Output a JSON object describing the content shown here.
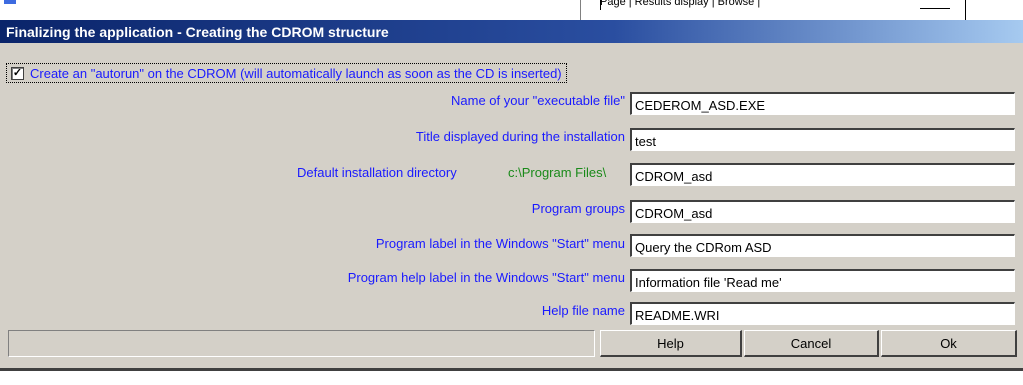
{
  "background_window": {
    "tabs_text": "Page | Results display | Browse |"
  },
  "dialog": {
    "title": "Finalizing the application - Creating the CDROM structure",
    "autorun": {
      "checked": true,
      "check_mark": "☑",
      "label": "Create an \"autorun\" on the CDROM (will automatically launch as soon as the CD is inserted)"
    },
    "fields": {
      "executable": {
        "label": "Name of your \"executable file\"",
        "value": "CEDEROM_ASD.EXE"
      },
      "install_title": {
        "label": "Title displayed during the installation",
        "value": "test"
      },
      "install_dir": {
        "label": "Default installation directory",
        "prefix": "c:\\Program Files\\",
        "value": "CDROM_asd"
      },
      "program_groups": {
        "label": "Program groups",
        "value": "CDROM_asd"
      },
      "program_label": {
        "label": "Program label in the Windows \"Start\" menu",
        "value": "Query the CDRom ASD"
      },
      "help_label": {
        "label": "Program help label in the Windows \"Start\" menu",
        "value": "Information file 'Read me'"
      },
      "help_file": {
        "label": "Help file name",
        "value": "README.WRI"
      }
    },
    "status_text": "",
    "buttons": {
      "help": "Help",
      "cancel": "Cancel",
      "ok": "Ok"
    }
  },
  "colors": {
    "label_blue": "#1a1aff",
    "path_green": "#1a8a1a",
    "title_bar": "#0a246a",
    "dialog_face": "#d4d0c8"
  }
}
